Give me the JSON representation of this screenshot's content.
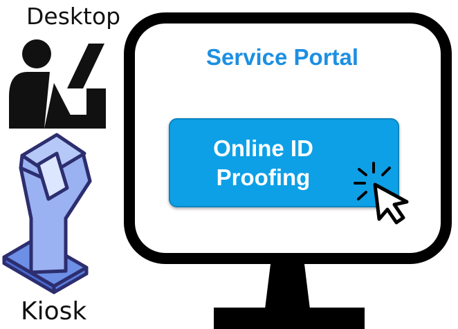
{
  "labels": {
    "desktop": "Desktop",
    "kiosk": "Kiosk"
  },
  "portal": {
    "title": "Service Portal",
    "button_line1": "Online ID",
    "button_line2": "Proofing"
  },
  "colors": {
    "title_blue": "#1d8fe1",
    "button_blue": "#0ea0e6",
    "button_text": "#ffffff",
    "kiosk_fill": "#9ab1f2",
    "kiosk_stroke": "#2d2e6f",
    "monitor_frame": "#000000"
  },
  "icons": [
    "desktop-user-icon",
    "kiosk-icon",
    "monitor-icon",
    "click-cursor-icon"
  ]
}
